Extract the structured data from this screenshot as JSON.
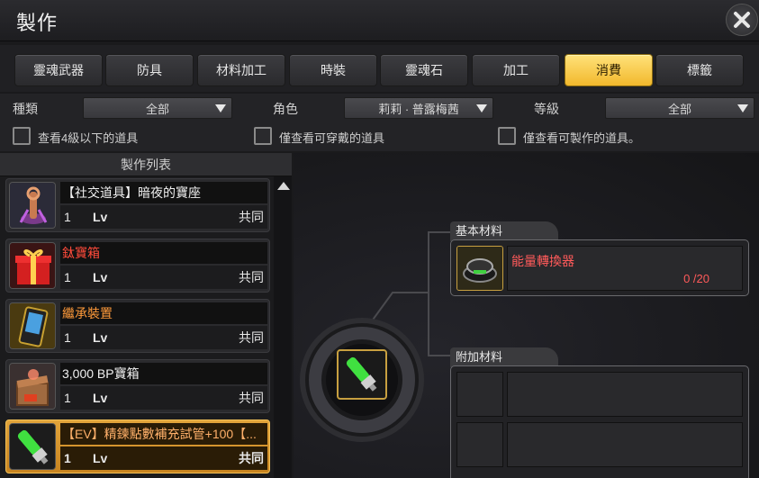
{
  "window": {
    "title": "製作",
    "close_icon": "close-icon"
  },
  "tabs": [
    {
      "label": "靈魂武器",
      "active": false
    },
    {
      "label": "防具",
      "active": false
    },
    {
      "label": "材料加工",
      "active": false
    },
    {
      "label": "時裝",
      "active": false
    },
    {
      "label": "靈魂石",
      "active": false
    },
    {
      "label": "加工",
      "active": false
    },
    {
      "label": "消費",
      "active": true
    },
    {
      "label": "標籤",
      "active": false
    }
  ],
  "filters": {
    "type_label": "種類",
    "type_value": "全部",
    "role_label": "角色",
    "role_value": "莉莉 · 普露梅茜",
    "grade_label": "等級",
    "grade_value": "全部",
    "check_below4": "查看4級以下的道具",
    "check_wearable": "僅查看可穿戴的道具",
    "check_craftable": "僅查看可製作的道具。"
  },
  "list": {
    "header": "製作列表",
    "items": [
      {
        "name": "【社交道具】暗夜的寶座",
        "level": "1",
        "lv_label": "Lv",
        "scope": "共同",
        "name_color": "#f0f0f0",
        "icon": "throne-icon"
      },
      {
        "name": "鈦寶箱",
        "level": "1",
        "lv_label": "Lv",
        "scope": "共同",
        "name_color": "#ff4a3a",
        "icon": "gift-box-icon"
      },
      {
        "name": "繼承裝置",
        "level": "1",
        "lv_label": "Lv",
        "scope": "共同",
        "name_color": "#ff9a3a",
        "icon": "device-icon"
      },
      {
        "name": "3,000 BP寶箱",
        "level": "1",
        "lv_label": "Lv",
        "scope": "共同",
        "name_color": "#f0f0f0",
        "icon": "bp-box-icon"
      },
      {
        "name": "【EV】精鍊點數補充試管+100【...",
        "level": "1",
        "lv_label": "Lv",
        "scope": "共同",
        "name_color": "#ffb06a",
        "icon": "test-tube-icon",
        "selected": true
      }
    ]
  },
  "materials": {
    "basic_label": "基本材料",
    "basic_item_name": "能量轉換器",
    "basic_item_count": "0 /20",
    "extra_label": "附加材料"
  },
  "colors": {
    "accent": "#f2b82c",
    "red_text": "#ff4a3a",
    "orange_text": "#ff9a3a"
  }
}
